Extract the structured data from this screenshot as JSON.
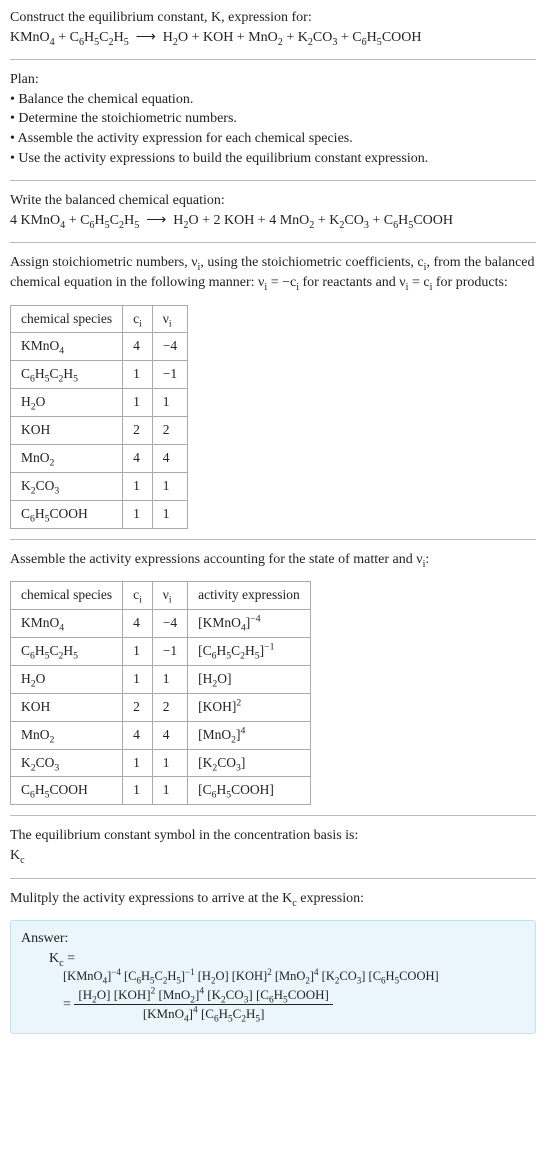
{
  "intro": {
    "line1": "Construct the equilibrium constant, K, expression for:",
    "eq1_html": "KMnO<sub>4</sub> + C<sub>6</sub>H<sub>5</sub>C<sub>2</sub>H<sub>5</sub> &nbsp;⟶&nbsp; H<sub>2</sub>O + KOH + MnO<sub>2</sub> + K<sub>2</sub>CO<sub>3</sub> + C<sub>6</sub>H<sub>5</sub>COOH"
  },
  "plan": {
    "title": "Plan:",
    "items": [
      "• Balance the chemical equation.",
      "• Determine the stoichiometric numbers.",
      "• Assemble the activity expression for each chemical species.",
      "• Use the activity expressions to build the equilibrium constant expression."
    ]
  },
  "balance": {
    "title": "Write the balanced chemical equation:",
    "eq_html": "4 KMnO<sub>4</sub> + C<sub>6</sub>H<sub>5</sub>C<sub>2</sub>H<sub>5</sub> &nbsp;⟶&nbsp; H<sub>2</sub>O + 2 KOH + 4 MnO<sub>2</sub> + K<sub>2</sub>CO<sub>3</sub> + C<sub>6</sub>H<sub>5</sub>COOH"
  },
  "assign": {
    "text_html": "Assign stoichiometric numbers, ν<sub>i</sub>, using the stoichiometric coefficients, c<sub>i</sub>, from the balanced chemical equation in the following manner: ν<sub>i</sub> = −c<sub>i</sub> for reactants and ν<sub>i</sub> = c<sub>i</sub> for products:"
  },
  "table1": {
    "headers": {
      "c0": "chemical species",
      "c1_html": "c<sub>i</sub>",
      "c2_html": "ν<sub>i</sub>"
    },
    "rows": [
      {
        "sp_html": "KMnO<sub>4</sub>",
        "c": "4",
        "v": "−4"
      },
      {
        "sp_html": "C<sub>6</sub>H<sub>5</sub>C<sub>2</sub>H<sub>5</sub>",
        "c": "1",
        "v": "−1"
      },
      {
        "sp_html": "H<sub>2</sub>O",
        "c": "1",
        "v": "1"
      },
      {
        "sp_html": "KOH",
        "c": "2",
        "v": "2"
      },
      {
        "sp_html": "MnO<sub>2</sub>",
        "c": "4",
        "v": "4"
      },
      {
        "sp_html": "K<sub>2</sub>CO<sub>3</sub>",
        "c": "1",
        "v": "1"
      },
      {
        "sp_html": "C<sub>6</sub>H<sub>5</sub>COOH",
        "c": "1",
        "v": "1"
      }
    ]
  },
  "assemble_text_html": "Assemble the activity expressions accounting for the state of matter and ν<sub>i</sub>:",
  "table2": {
    "headers": {
      "c0": "chemical species",
      "c1_html": "c<sub>i</sub>",
      "c2_html": "ν<sub>i</sub>",
      "c3": "activity expression"
    },
    "rows": [
      {
        "sp_html": "KMnO<sub>4</sub>",
        "c": "4",
        "v": "−4",
        "a_html": "[KMnO<sub>4</sub>]<sup>−4</sup>"
      },
      {
        "sp_html": "C<sub>6</sub>H<sub>5</sub>C<sub>2</sub>H<sub>5</sub>",
        "c": "1",
        "v": "−1",
        "a_html": "[C<sub>6</sub>H<sub>5</sub>C<sub>2</sub>H<sub>5</sub>]<sup>−1</sup>"
      },
      {
        "sp_html": "H<sub>2</sub>O",
        "c": "1",
        "v": "1",
        "a_html": "[H<sub>2</sub>O]"
      },
      {
        "sp_html": "KOH",
        "c": "2",
        "v": "2",
        "a_html": "[KOH]<sup>2</sup>"
      },
      {
        "sp_html": "MnO<sub>2</sub>",
        "c": "4",
        "v": "4",
        "a_html": "[MnO<sub>2</sub>]<sup>4</sup>"
      },
      {
        "sp_html": "K<sub>2</sub>CO<sub>3</sub>",
        "c": "1",
        "v": "1",
        "a_html": "[K<sub>2</sub>CO<sub>3</sub>]"
      },
      {
        "sp_html": "C<sub>6</sub>H<sub>5</sub>COOH",
        "c": "1",
        "v": "1",
        "a_html": "[C<sub>6</sub>H<sub>5</sub>COOH]"
      }
    ]
  },
  "symbol": {
    "line1": "The equilibrium constant symbol in the concentration basis is:",
    "line2_html": "K<sub>c</sub>"
  },
  "multiply_html": "Mulitply the activity expressions to arrive at the K<sub>c</sub> expression:",
  "answer": {
    "label": "Answer:",
    "lhs_html": "K<sub>c</sub> = ",
    "rhs_line_html": "[KMnO<sub>4</sub>]<sup>−4</sup> [C<sub>6</sub>H<sub>5</sub>C<sub>2</sub>H<sub>5</sub>]<sup>−1</sup> [H<sub>2</sub>O] [KOH]<sup>2</sup> [MnO<sub>2</sub>]<sup>4</sup> [K<sub>2</sub>CO<sub>3</sub>] [C<sub>6</sub>H<sub>5</sub>COOH]",
    "eq_sign": " = ",
    "frac_num_html": "[H<sub>2</sub>O] [KOH]<sup>2</sup> [MnO<sub>2</sub>]<sup>4</sup> [K<sub>2</sub>CO<sub>3</sub>] [C<sub>6</sub>H<sub>5</sub>COOH]",
    "frac_den_html": "[KMnO<sub>4</sub>]<sup>4</sup> [C<sub>6</sub>H<sub>5</sub>C<sub>2</sub>H<sub>5</sub>]"
  }
}
